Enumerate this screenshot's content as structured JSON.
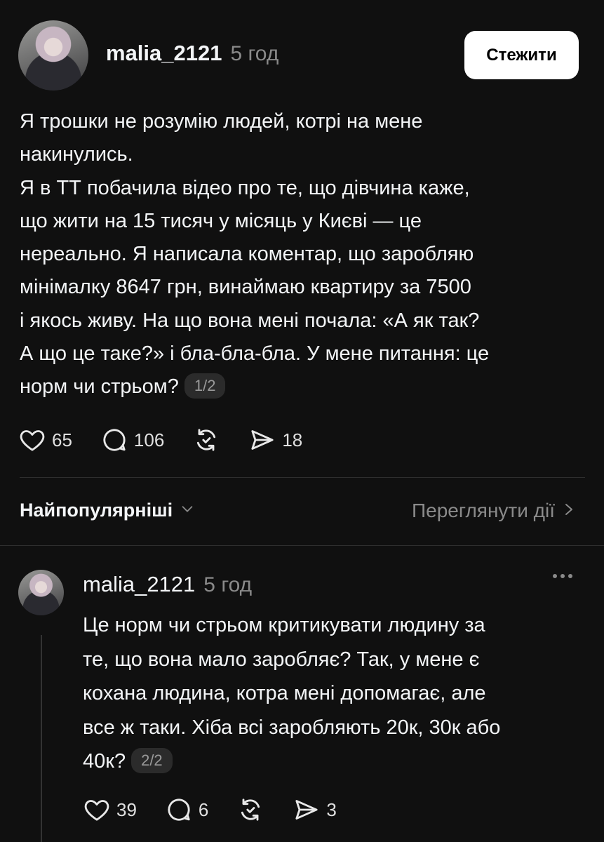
{
  "post": {
    "username": "malia_2121",
    "time": "5 год",
    "follow_label": "Стежити",
    "text": "Я трошки не розумію людей, котрі на мене\nнакинулись.\nЯ в ТТ побачила відео про те, що дівчина каже,\nщо жити на 15 тисяч у місяць у Києві — це\nнереально. Я написала коментар, що заробляю\nмінімалку 8647 грн, винаймаю квартиру за 7500\nі якось живу. На що вона мені почала: «А як так?\nА що це таке?» і бла-бла-бла. У мене питання: це\nнорм чи стрьом?",
    "thread_index": "1/2",
    "likes": "65",
    "comments": "106",
    "shares": "18"
  },
  "sort": {
    "label": "Найпопулярніші",
    "activity_label": "Переглянути дії"
  },
  "reply": {
    "username": "malia_2121",
    "time": "5 год",
    "text": "Це норм чи стрьом критикувати людину за\nте, що вона мало заробляє? Так, у мене є\nкохана людина, котра мені допомагає, але\nвсе ж таки. Хіба всі заробляють 20к, 30к або\n40к?",
    "thread_index": "2/2",
    "likes": "39",
    "comments": "6",
    "shares": "3"
  },
  "icons": {
    "like": "heart-icon",
    "comment": "comment-icon",
    "repost": "repost-icon",
    "share": "send-icon",
    "sort": "chevron-down-icon",
    "activity": "chevron-right-icon",
    "more": "more-icon"
  },
  "colors": {
    "background": "#101010",
    "text": "#f3f5f7",
    "muted": "#8a8a8a",
    "button_bg": "#ffffff"
  }
}
